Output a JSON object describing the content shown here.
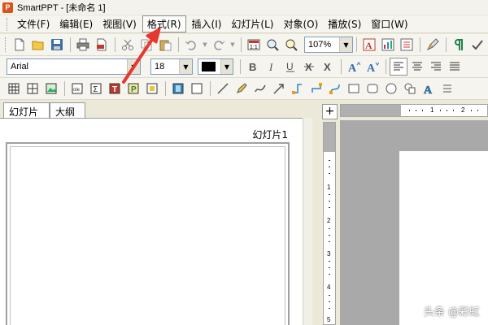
{
  "window": {
    "app_letter": "P",
    "title": "SmartPPT - [未命名 1]"
  },
  "menubar": {
    "items": [
      {
        "id": "file",
        "label": "文件(F)"
      },
      {
        "id": "edit",
        "label": "编辑(E)"
      },
      {
        "id": "view",
        "label": "视图(V)"
      },
      {
        "id": "format",
        "label": "格式(R)"
      },
      {
        "id": "insert",
        "label": "插入(I)"
      },
      {
        "id": "slideshow",
        "label": "幻灯片(L)"
      },
      {
        "id": "object",
        "label": "对象(O)"
      },
      {
        "id": "play",
        "label": "播放(S)"
      },
      {
        "id": "window",
        "label": "窗口(W)"
      }
    ]
  },
  "toolbar": {
    "zoom_value": "107%",
    "font_name": "Arial",
    "font_size": "18",
    "font_color": "#000000"
  },
  "left_panel": {
    "tabs": [
      {
        "label": "幻灯片"
      },
      {
        "label": "大纲"
      }
    ],
    "slide_label": "幻灯片1"
  },
  "ruler": {
    "h_labels": [
      "1",
      "2"
    ],
    "v_labels": [
      "1",
      "2",
      "3",
      "4",
      "5"
    ],
    "corner_symbol": "+"
  },
  "watermark": "头条 @彩虹",
  "colors": {
    "annotation_arrow": "#e8372e",
    "canvas_grey": "#a9a9a9"
  }
}
